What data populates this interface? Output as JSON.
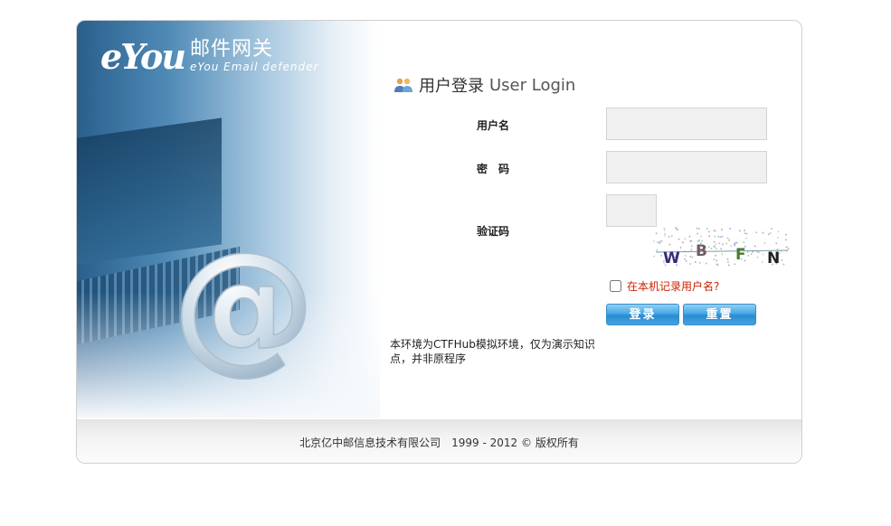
{
  "brand": {
    "logo_text": "eYou",
    "name_cn": "邮件网关",
    "name_en": "eYou Email defender"
  },
  "login": {
    "title_cn": "用户登录",
    "title_en": "User Login",
    "username_label": "用户名",
    "password_label": "密　码",
    "captcha_label": "验证码",
    "username_value": "",
    "password_value": "",
    "captcha_value": "",
    "captcha_text": [
      "W",
      "B",
      "F",
      "N"
    ],
    "remember_label": "在本机记录用户名?",
    "remember_checked": false,
    "login_button": "登录",
    "reset_button": "重置"
  },
  "notice": "本环境为CTFHub模拟环境，仅为演示知识点，并非原程序",
  "footer": {
    "copyright": "北京亿中邮信息技术有限公司　1999 - 2012 © 版权所有"
  },
  "colors": {
    "button_blue": "#2a8bd0",
    "remember_red": "#cc2200",
    "hero_blue": "#2a5f8c"
  }
}
